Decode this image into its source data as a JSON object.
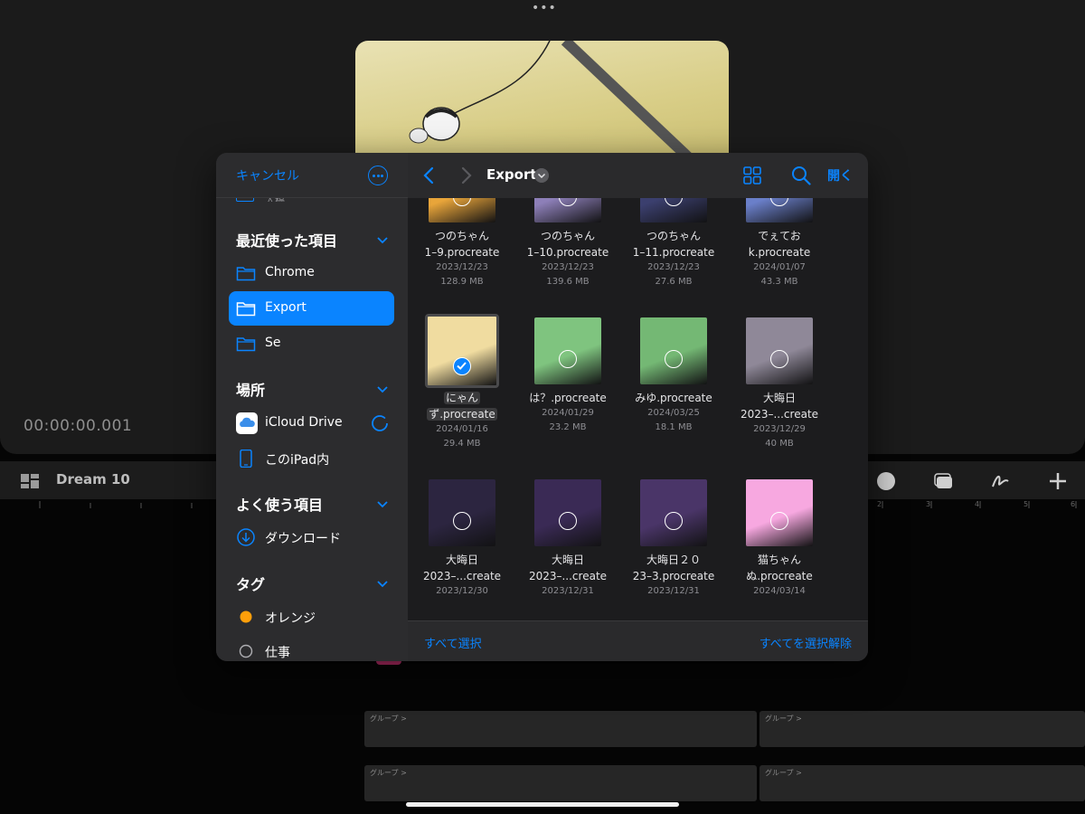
{
  "background_app": {
    "timecode": "00:00:00.001",
    "project_name": "Dream 10",
    "track_label": "グループ >",
    "ruler_ticks": [
      "2",
      "3",
      "4",
      "5",
      "6"
    ]
  },
  "picker": {
    "sidebar": {
      "cancel_label": "キャンセル",
      "cut_item_label": "入稿",
      "sections": {
        "recents": {
          "title": "最近使った項目",
          "items": [
            {
              "label": "Chrome",
              "icon": "folder-icon"
            },
            {
              "label": "Export",
              "icon": "folder-icon",
              "selected": true
            },
            {
              "label": "Se",
              "icon": "folder-icon"
            }
          ]
        },
        "locations": {
          "title": "場所",
          "items": [
            {
              "label": "iCloud Drive",
              "icon": "icloud-icon"
            },
            {
              "label": "このiPad内",
              "icon": "ipad-icon"
            }
          ]
        },
        "favorites": {
          "title": "よく使う項目",
          "items": [
            {
              "label": "ダウンロード",
              "icon": "download-icon"
            }
          ]
        },
        "tags": {
          "title": "タグ",
          "items": [
            {
              "label": "オレンジ",
              "color": "#ff9f0a"
            },
            {
              "label": "仕事",
              "color": ""
            }
          ]
        }
      }
    },
    "header": {
      "folder_title": "Export",
      "open_label": "開く"
    },
    "files": [
      {
        "name1": "つのちゃん",
        "name2": "1–9.procreate",
        "date": "2023/12/23",
        "size": "128.9 MB",
        "color": "#e8a53a"
      },
      {
        "name1": "つのちゃん",
        "name2": "1–10.procreate",
        "date": "2023/12/23",
        "size": "139.6 MB",
        "color": "#8d7fb8"
      },
      {
        "name1": "つのちゃん",
        "name2": "1–11.procreate",
        "date": "2023/12/23",
        "size": "27.6 MB",
        "color": "#3b3f6e"
      },
      {
        "name1": "でぇてお",
        "name2": "k.procreate",
        "date": "2024/01/07",
        "size": "43.3 MB",
        "color": "#6a7fc9"
      },
      {
        "name1": "にゃん",
        "name2": "ず.procreate",
        "date": "2024/01/16",
        "size": "29.4 MB",
        "color": "#f0dca0",
        "selected": true
      },
      {
        "name1": "は？.procreate",
        "name2": "",
        "date": "2024/01/29",
        "size": "23.2 MB",
        "color": "#7fc47f"
      },
      {
        "name1": "みゆ.procreate",
        "name2": "",
        "date": "2024/03/25",
        "size": "18.1 MB",
        "color": "#74b874"
      },
      {
        "name1": "大晦日",
        "name2": "2023–...create",
        "date": "2023/12/29",
        "size": "40 MB",
        "color": "#8f8898"
      },
      {
        "name1": "大晦日",
        "name2": "2023–...create",
        "date": "2023/12/30",
        "size": "",
        "color": "#2c2540"
      },
      {
        "name1": "大晦日",
        "name2": "2023–...create",
        "date": "2023/12/31",
        "size": "",
        "color": "#3a2a55"
      },
      {
        "name1": "大晦日２０",
        "name2": "23–3.procreate",
        "date": "2023/12/31",
        "size": "",
        "color": "#4a3568"
      },
      {
        "name1": "猫ちゃん",
        "name2": "ぬ.procreate",
        "date": "2024/03/14",
        "size": "",
        "color": "#f7a8e0"
      }
    ],
    "footer": {
      "select_all": "すべて選択",
      "deselect_all": "すべてを選択解除"
    },
    "accent_color": "#0a84ff"
  }
}
